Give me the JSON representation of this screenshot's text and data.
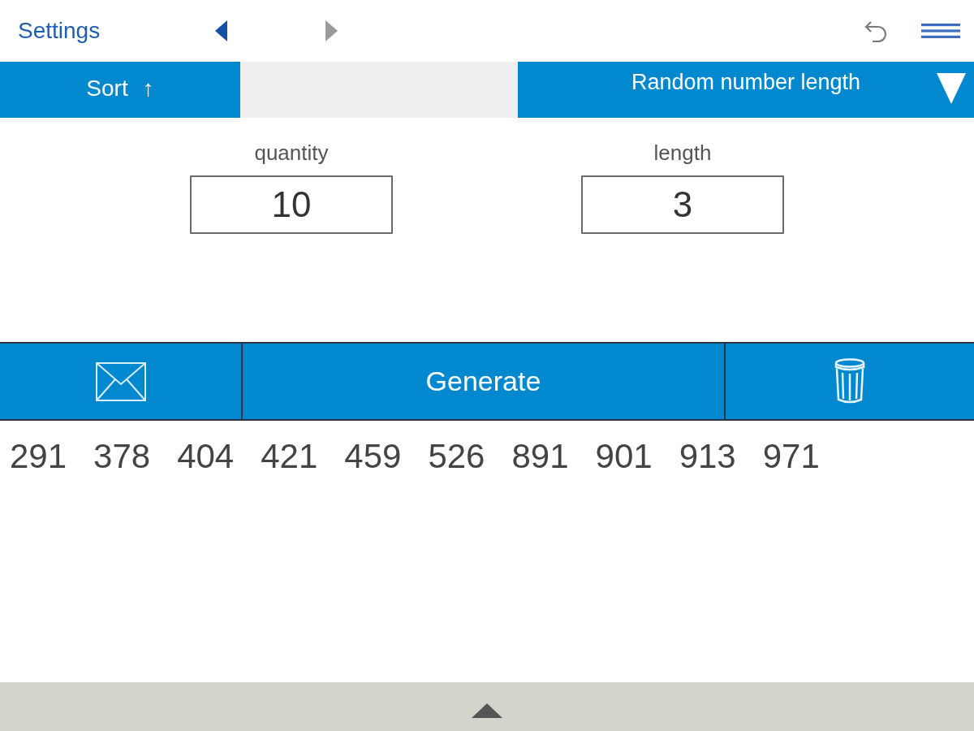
{
  "header": {
    "title": "Settings",
    "nav": [
      {
        "kind": "previous",
        "disabled": false
      },
      {
        "kind": "next",
        "disabled": true
      }
    ]
  },
  "toolbar": {
    "sort": {
      "label": "Sort",
      "arrow": "↑"
    },
    "mode": {
      "label": "Random number length"
    }
  },
  "fields": [
    {
      "label": "quantity",
      "value": "10"
    },
    {
      "label": "length",
      "value": "3"
    }
  ],
  "actions": [
    {
      "kind": "email"
    },
    {
      "kind": "generate",
      "label": "Generate"
    },
    {
      "kind": "delete"
    }
  ],
  "results": [
    "291",
    "378",
    "404",
    "421",
    "459",
    "526",
    "891",
    "901",
    "913",
    "971"
  ]
}
